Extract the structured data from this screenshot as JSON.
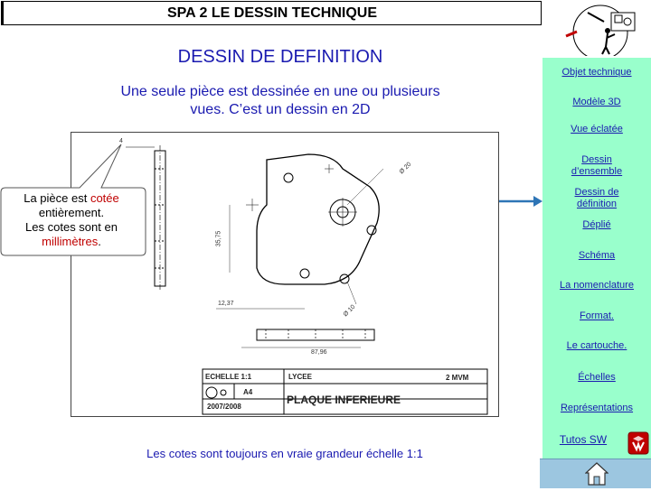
{
  "header": {
    "title": "SPA 2   LE DESSIN TECHNIQUE"
  },
  "main": {
    "subtitle": "DESSIN DE DEFINITION",
    "intro": "Une seule pièce est dessinée en une ou plusieurs vues. C’est un dessin en 2D",
    "footer": "Les cotes sont toujours en vraie grandeur   échelle 1:1"
  },
  "callout": {
    "line1_prefix": "La pièce est ",
    "line1_highlight": "cotée",
    "line2": "entièrement.",
    "line3": "Les cotes sont en",
    "line4_highlight": "millimètres",
    "line4_suffix": "."
  },
  "drawing": {
    "dims": {
      "d20": "Ø 20",
      "d10": "Ø 10",
      "h3575": "35,75",
      "w1237": "12,37",
      "w8796": "87,96",
      "leader": "4"
    },
    "titleblock": {
      "scale": "ECHELLE 1:1",
      "school": "LYCEE",
      "class": "2 MVM",
      "format": "A4",
      "part": "PLAQUE INFERIEURE",
      "year": "2007/2008"
    }
  },
  "sidebar": {
    "items": [
      {
        "label": "Objet technique"
      },
      {
        "label": "Modèle 3D "
      },
      {
        "label": "Vue éclatée"
      },
      {
        "label": "Dessin d’ensemble"
      },
      {
        "label": "Dessin de définition"
      },
      {
        "label": "Déplié"
      },
      {
        "label": "Schéma"
      },
      {
        "label": "La nomenclature"
      },
      {
        "label": "Format.     "
      },
      {
        "label": "Le cartouche."
      },
      {
        "label": "Échelles"
      },
      {
        "label": "Représentations"
      }
    ],
    "tutos": "Tutos SW"
  },
  "colors": {
    "link": "#1a1ab0",
    "sidebar_bg": "#99ffcc",
    "highlight": "#c00000",
    "arrow": "#2e75b6"
  },
  "icons": {
    "logo": "technician-drawing-logo",
    "home": "home-icon",
    "solidworks": "solidworks-icon"
  }
}
